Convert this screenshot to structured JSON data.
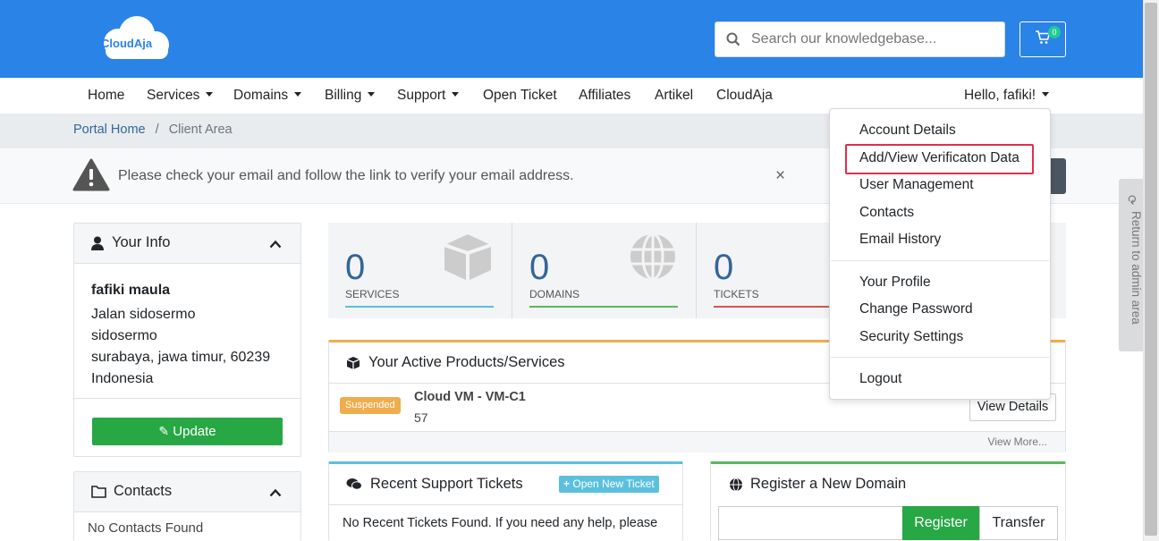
{
  "brand": {
    "logo_text": "CloudAja",
    "accent": "#2a83e6"
  },
  "search": {
    "placeholder": "Search our knowledgebase...",
    "icon": "search-icon"
  },
  "cart": {
    "count": "0",
    "icon": "cart-icon"
  },
  "nav": {
    "items": [
      {
        "label": "Home",
        "dropdown": false
      },
      {
        "label": "Services",
        "dropdown": true
      },
      {
        "label": "Domains",
        "dropdown": true
      },
      {
        "label": "Billing",
        "dropdown": true
      },
      {
        "label": "Support",
        "dropdown": true
      },
      {
        "label": "Open Ticket",
        "dropdown": false
      },
      {
        "label": "Affiliates",
        "dropdown": false
      },
      {
        "label": "Artikel",
        "dropdown": false
      },
      {
        "label": "CloudAja",
        "dropdown": false
      }
    ],
    "user_greeting": "Hello, fafiki!"
  },
  "breadcrumb": {
    "home": "Portal Home",
    "separator": "/",
    "current": "Client Area"
  },
  "alert": {
    "message": "Please check your email and follow the link to verify your email address.",
    "close": "×"
  },
  "info_panel": {
    "title": "Your Info",
    "name": "fafiki maula",
    "address": [
      "Jalan sidosermo",
      "sidosermo",
      "surabaya, jawa timur, 60239",
      "Indonesia"
    ],
    "update_label": "Update"
  },
  "contacts_panel": {
    "title": "Contacts",
    "empty": "No Contacts Found"
  },
  "stats": [
    {
      "value": "0",
      "label": "SERVICES",
      "color": "#5bc0de"
    },
    {
      "value": "0",
      "label": "DOMAINS",
      "color": "#5cb85c"
    },
    {
      "value": "0",
      "label": "TICKETS",
      "color": "#d9534f"
    }
  ],
  "products_panel": {
    "title": "Your Active Products/Services",
    "status": "Suspended",
    "product_name": "Cloud VM - VM-C1",
    "product_id": "57",
    "view_details": "View Details",
    "view_more": "View More..."
  },
  "tickets_panel": {
    "title": "Recent Support Tickets",
    "button": "Open New Ticket",
    "text": "No Recent Tickets Found. If you need any help, please"
  },
  "domain_panel": {
    "title": "Register a New Domain",
    "register": "Register",
    "transfer": "Transfer"
  },
  "dropdown": {
    "items": [
      "Account Details",
      "Add/View Verificaton Data",
      "User Management",
      "Contacts",
      "Email History"
    ],
    "items2": [
      "Your Profile",
      "Change Password",
      "Security Settings"
    ],
    "logout": "Logout"
  },
  "admin_tab": {
    "label": "Return to admin area"
  }
}
